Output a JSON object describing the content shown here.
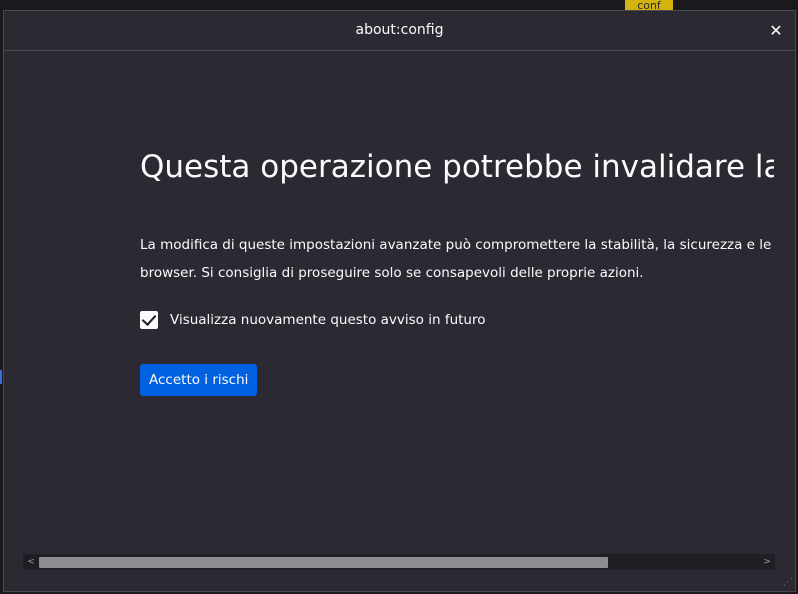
{
  "background": {
    "tag_label": "conf"
  },
  "dialog": {
    "title": "about:config",
    "close_glyph": "✕"
  },
  "warning": {
    "heading": "Questa operazione potrebbe invalidare la garanzia!",
    "description_line1": "La modifica di queste impostazioni avanzate può compromettere la stabilità, la sicurezza e le prestazioni di questa applicazione. Si consiglia di proseguire solo se consapevoli delle proprie azioni.",
    "description_line1_visible": "La modifica di queste impostazioni avanzate può compromettere la stabilità, la sicurezza e le prestazioni di questo",
    "description_line2": "browser. Si consiglia di proseguire solo se consapevoli delle proprie azioni.",
    "checkbox_label": "Visualizza nuovamente questo avviso in futuro",
    "checkbox_checked": true,
    "accept_label": "Accetto i rischi"
  },
  "scrollbar": {
    "left_arrow": "<",
    "right_arrow": ">",
    "thumb_fraction": 0.79
  },
  "colors": {
    "dialog_bg": "#2b2a33",
    "text": "#fbfbfe",
    "accent": "#0061e0",
    "tag": "#d4b30f"
  }
}
